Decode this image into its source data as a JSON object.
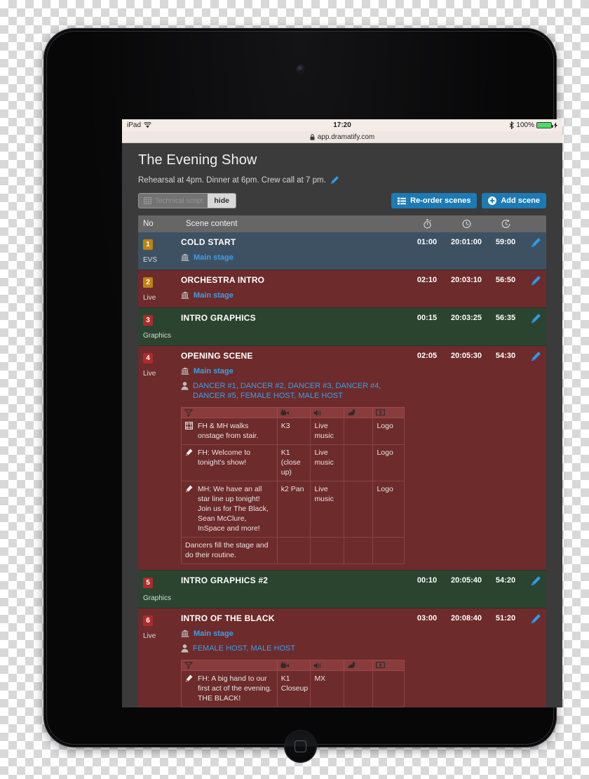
{
  "statusbar": {
    "carrier": "iPad",
    "wifi_icon": "wifi-icon",
    "time": "17:20",
    "bluetooth_icon": "bluetooth-icon",
    "battery_percent": "100%",
    "battery_level": 100,
    "charging": true
  },
  "urlbar": {
    "lock_icon": "lock-icon",
    "url": "app.dramatify.com"
  },
  "header": {
    "title": "The Evening Show",
    "subtitle": "Rehearsal at 4pm. Dinner at 6pm. Crew call at 7 pm.",
    "edit_icon": "pencil-icon"
  },
  "toolbar": {
    "technical_script_label": "Technical script",
    "technical_script_icon": "grid-icon",
    "hide_label": "hide",
    "reorder_label": "Re-order scenes",
    "reorder_icon": "list-icon",
    "add_scene_label": "Add scene",
    "add_scene_icon": "plus-circle-icon"
  },
  "table": {
    "columns": {
      "no": "No",
      "content": "Scene content",
      "duration_icon": "stopwatch-icon",
      "clock_icon": "clock-icon",
      "countdown_icon": "clock-back-icon"
    },
    "script_columns": {
      "script_icon": "script-icon",
      "camera_icon": "video-camera-icon",
      "sound_icon": "speaker-icon",
      "light_icon": "lighting-icon",
      "graphics_icon": "screen-icon"
    }
  },
  "colors": {
    "evs_row": "#3e5163",
    "live_row": "#6d2b2b",
    "graphics_row": "#2b4430",
    "badge_gold": "#c0820f",
    "badge_red": "#ad2b2b",
    "link_blue": "#3ba0e8",
    "button_blue": "#1c7ab5",
    "page_bg": "#3b3b3b",
    "header_bg": "#666666"
  },
  "scenes": [
    {
      "no": "1",
      "badge_color": "gold",
      "type": "EVS",
      "row_style": "evs",
      "title": "COLD START",
      "duration": "01:00",
      "clock": "20:01:00",
      "countdown": "59:00",
      "location": "Main stage",
      "cast": null,
      "script_rows": []
    },
    {
      "no": "2",
      "badge_color": "gold",
      "type": "Live",
      "row_style": "live",
      "title": "ORCHESTRA INTRO",
      "duration": "02:10",
      "clock": "20:03:10",
      "countdown": "56:50",
      "location": "Main stage",
      "cast": null,
      "script_rows": []
    },
    {
      "no": "3",
      "badge_color": "red",
      "type": "Graphics",
      "row_style": "graphics",
      "title": "INTRO GRAPHICS",
      "duration": "00:15",
      "clock": "20:03:25",
      "countdown": "56:35",
      "location": null,
      "cast": null,
      "script_rows": []
    },
    {
      "no": "4",
      "badge_color": "red",
      "type": "Live",
      "row_style": "live",
      "title": "OPENING SCENE",
      "duration": "02:05",
      "clock": "20:05:30",
      "countdown": "54:30",
      "location": "Main stage",
      "cast": "DANCER #1, DANCER #2, DANCER #3, DANCER #4, DANCER #5, FEMALE HOST, MALE HOST",
      "script_rows": [
        {
          "icon": "film-icon",
          "text": "FH & MH walks onstage from stair.",
          "camera": "K3",
          "sound": "Live music",
          "light": "",
          "graphics": "Logo"
        },
        {
          "icon": "microphone-icon",
          "text": "FH: Welcome to tonight's show!",
          "camera": "K1 (close up)",
          "sound": "Live music",
          "light": "",
          "graphics": "Logo"
        },
        {
          "icon": "microphone-icon",
          "text": "MH: We have an all star line up tonight! Join us for The Black, Sean McClure, InSpace and more!",
          "camera": "k2 Pan",
          "sound": "Live music",
          "light": "",
          "graphics": "Logo"
        },
        {
          "icon": "",
          "text": "Dancers fill the stage and do their routine.",
          "camera": "",
          "sound": "",
          "light": "",
          "graphics": ""
        }
      ]
    },
    {
      "no": "5",
      "badge_color": "red",
      "type": "Graphics",
      "row_style": "graphics",
      "title": "INTRO GRAPHICS #2",
      "duration": "00:10",
      "clock": "20:05:40",
      "countdown": "54:20",
      "location": null,
      "cast": null,
      "script_rows": []
    },
    {
      "no": "6",
      "badge_color": "red",
      "type": "Live",
      "row_style": "live",
      "title": "INTRO OF THE BLACK",
      "duration": "03:00",
      "clock": "20:08:40",
      "countdown": "51:20",
      "location": "Main stage",
      "cast": "FEMALE HOST, MALE HOST",
      "script_rows": [
        {
          "icon": "microphone-icon",
          "text": "FH: A big hand to our first act of the evening. THE BLACK!",
          "camera": "K1 Closeup",
          "sound": "MX",
          "light": "",
          "graphics": ""
        }
      ]
    }
  ]
}
